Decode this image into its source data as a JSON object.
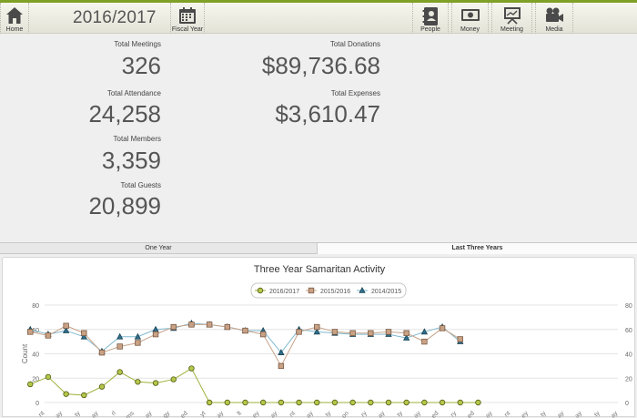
{
  "toolbar": {
    "home_label": "Home",
    "year": "2016/2017",
    "fiscal_year_label": "Fiscal Year",
    "people_label": "People",
    "money_label": "Money",
    "meeting_label": "Meeting",
    "media_label": "Media"
  },
  "stats": {
    "total_meetings_label": "Total Meetings",
    "total_meetings_value": "326",
    "total_attendance_label": "Total Attendance",
    "total_attendance_value": "24,258",
    "total_members_label": "Total Members",
    "total_members_value": "3,359",
    "total_guests_label": "Total Guests",
    "total_guests_value": "20,899",
    "total_donations_label": "Total Donations",
    "total_donations_value": "$89,736.68",
    "total_expenses_label": "Total Expenses",
    "total_expenses_value": "$3,610.47"
  },
  "tabs": {
    "one_year": "One Year",
    "three_years": "Last Three Years"
  },
  "colors": {
    "accent": "#7ea126",
    "series_2016_2017": "#9fb03a",
    "series_2015_2016": "#c8a48a",
    "series_2014_2015": "#7fb9cf"
  },
  "chart_data": {
    "type": "line",
    "title": "Three Year Samaritan Activity",
    "ylabel": "Count",
    "ylim": [
      0,
      80
    ],
    "yticks": [
      0,
      20,
      40,
      60,
      80
    ],
    "legend_position": "top",
    "series": [
      {
        "name": "2016/2017",
        "marker": "circle",
        "values": [
          15,
          21,
          7,
          6,
          13,
          25,
          17,
          16,
          19,
          28,
          0,
          0,
          0,
          0,
          0,
          0,
          0,
          0,
          0,
          0,
          0,
          0,
          0,
          0,
          0,
          0
        ]
      },
      {
        "name": "2015/2016",
        "marker": "square",
        "values": [
          58,
          55,
          63,
          57,
          41,
          46,
          49,
          56,
          62,
          64,
          64,
          62,
          59,
          56,
          30,
          58,
          62,
          58,
          57,
          57,
          58,
          57,
          50,
          61,
          52,
          null
        ]
      },
      {
        "name": "2014/2015",
        "marker": "triangle",
        "values": [
          60,
          56,
          59,
          54,
          42,
          54,
          54,
          60,
          61,
          65,
          64,
          62,
          59,
          59,
          41,
          60,
          58,
          57,
          56,
          56,
          56,
          53,
          58,
          62,
          50,
          null
        ]
      }
    ]
  }
}
